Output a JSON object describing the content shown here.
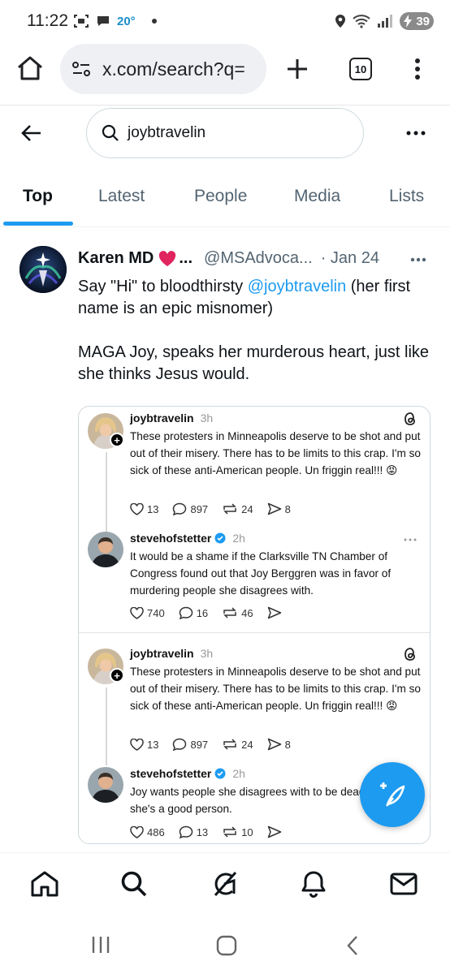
{
  "status_bar": {
    "time": "11:22",
    "temperature": "20°",
    "battery": "39"
  },
  "browser": {
    "url": "x.com/search?q=",
    "tab_count": "10"
  },
  "search": {
    "query": "joybtravelin"
  },
  "tabs": [
    {
      "label": "Top",
      "active": true
    },
    {
      "label": "Latest",
      "active": false
    },
    {
      "label": "People",
      "active": false
    },
    {
      "label": "Media",
      "active": false
    },
    {
      "label": "Lists",
      "active": false
    }
  ],
  "tweet": {
    "name": "Karen MD",
    "name_suffix": "...",
    "handle": "@MSAdvoca...",
    "date": "· Jan 24",
    "text_pre": "Say \"Hi\" to bloodthirsty ",
    "mention": "@joybtravelin",
    "text_post": " (her first name is an epic misnomer)",
    "text_2": "MAGA Joy, speaks her murderous heart, just like she thinks Jesus would."
  },
  "embedded_posts": [
    {
      "user": "joybtravelin",
      "time": "3h",
      "text": "These protesters in Minneapolis deserve to be shot and put out of their misery. There has to be limits to this crap. I'm so sick of these anti-American people. Un friggin real!!! 😡",
      "likes": "13",
      "replies": "897",
      "reposts": "24",
      "shares": "8"
    },
    {
      "user": "stevehofstetter",
      "time": "2h",
      "text": "It would be a shame if the Clarksville TN Chamber of Congress found out that Joy Berggren was in favor of murdering people she disagrees with.",
      "likes": "740",
      "replies": "16",
      "reposts": "46",
      "shares": ""
    },
    {
      "user": "joybtravelin",
      "time": "3h",
      "text": "These protesters in Minneapolis deserve to be shot and put out of their misery. There has to be limits to this crap. I'm so sick of these anti-American people. Un friggin real!!! 😡",
      "likes": "13",
      "replies": "897",
      "reposts": "24",
      "shares": "8"
    },
    {
      "user": "stevehofstetter",
      "time": "2h",
      "text": "Joy wants people she disagrees with to be dead because she's a good person.",
      "likes": "486",
      "replies": "13",
      "reposts": "10",
      "shares": ""
    }
  ],
  "colors": {
    "accent": "#1d9bf0",
    "text": "#0f1419",
    "muted": "#536471",
    "heart": "#e0245e"
  },
  "icons": {
    "nav": [
      "home-icon",
      "search-icon",
      "grok-icon",
      "notifications-icon",
      "messages-icon"
    ],
    "fab": "compose-post-icon"
  }
}
